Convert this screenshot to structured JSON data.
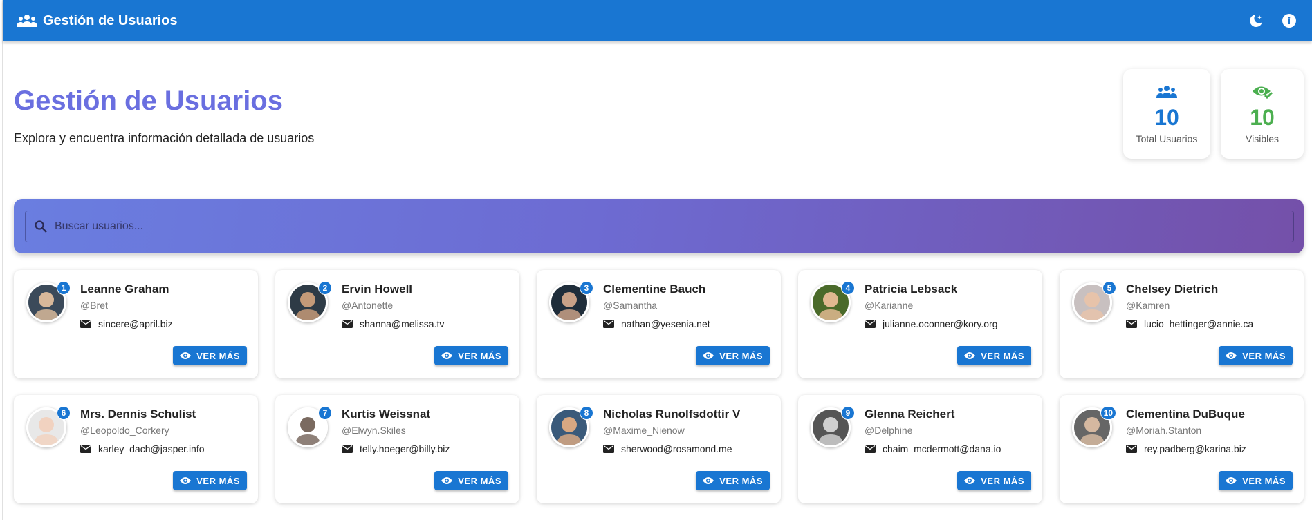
{
  "appbar": {
    "title": "Gestión de Usuarios",
    "logo_icon": "group-icon",
    "theme_toggle_icon": "dark-mode-icon",
    "info_icon": "info-icon",
    "color": "#1976d2"
  },
  "header": {
    "title": "Gestión de Usuarios",
    "subtitle": "Explora y encuentra información detallada de usuarios",
    "title_color": "#6a6fe0"
  },
  "stats": {
    "total": {
      "value": "10",
      "label": "Total Usuarios",
      "icon": "group-icon",
      "color": "#1976d2"
    },
    "visible": {
      "value": "10",
      "label": "Visibles",
      "icon": "visibility-check-icon",
      "color": "#4caf50"
    }
  },
  "search": {
    "placeholder": "Buscar usuarios...",
    "value": "",
    "icon": "search-icon"
  },
  "button_label": "VER MÁS",
  "users": [
    {
      "id": "1",
      "name": "Leanne Graham",
      "username": "@Bret",
      "email": "sincere@april.biz"
    },
    {
      "id": "2",
      "name": "Ervin Howell",
      "username": "@Antonette",
      "email": "shanna@melissa.tv"
    },
    {
      "id": "3",
      "name": "Clementine Bauch",
      "username": "@Samantha",
      "email": "nathan@yesenia.net"
    },
    {
      "id": "4",
      "name": "Patricia Lebsack",
      "username": "@Karianne",
      "email": "julianne.oconner@kory.org"
    },
    {
      "id": "5",
      "name": "Chelsey Dietrich",
      "username": "@Kamren",
      "email": "lucio_hettinger@annie.ca"
    },
    {
      "id": "6",
      "name": "Mrs. Dennis Schulist",
      "username": "@Leopoldo_Corkery",
      "email": "karley_dach@jasper.info"
    },
    {
      "id": "7",
      "name": "Kurtis Weissnat",
      "username": "@Elwyn.Skiles",
      "email": "telly.hoeger@billy.biz"
    },
    {
      "id": "8",
      "name": "Nicholas Runolfsdottir V",
      "username": "@Maxime_Nienow",
      "email": "sherwood@rosamond.me"
    },
    {
      "id": "9",
      "name": "Glenna Reichert",
      "username": "@Delphine",
      "email": "chaim_mcdermott@dana.io"
    },
    {
      "id": "10",
      "name": "Clementina DuBuque",
      "username": "@Moriah.Stanton",
      "email": "rey.padberg@karina.biz"
    }
  ]
}
